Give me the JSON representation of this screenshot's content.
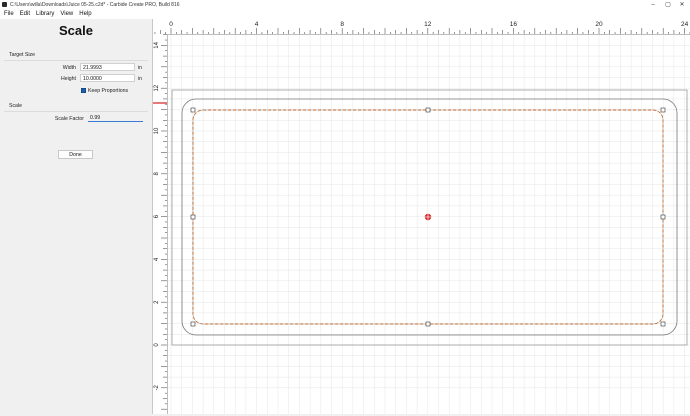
{
  "window": {
    "title": "C:\\Users\\willa\\Downloads\\Juice 05-25.c2d* - Carbide Create PRO, Build 816"
  },
  "menu": {
    "items": [
      {
        "label": "File"
      },
      {
        "label": "Edit"
      },
      {
        "label": "Library"
      },
      {
        "label": "View"
      },
      {
        "label": "Help"
      }
    ]
  },
  "panel": {
    "title": "Scale",
    "target_size": {
      "section_label": "Target Size",
      "width_label": "Width",
      "width_value": "21.9993",
      "width_unit": "in",
      "height_label": "Height",
      "height_value": "10.0000",
      "height_unit": "in",
      "keep_proportions_label": "Keep Proportions",
      "keep_proportions_checked": true
    },
    "scale": {
      "section_label": "Scale",
      "factor_label": "Scale Factor",
      "factor_value": "0.99"
    },
    "done_label": "Done"
  },
  "rulers": {
    "top_ticks": [
      "0",
      "4",
      "8",
      "12",
      "16",
      "20",
      "24"
    ],
    "left_ticks": [
      "14",
      "12",
      "10",
      "8",
      "6",
      "4",
      "2",
      "0",
      "-2"
    ]
  },
  "colors": {
    "selection_dash": "#d2691e",
    "grid": "#e6e6e6",
    "stock_outline": "#999999",
    "origin_marker": "#d62020"
  }
}
